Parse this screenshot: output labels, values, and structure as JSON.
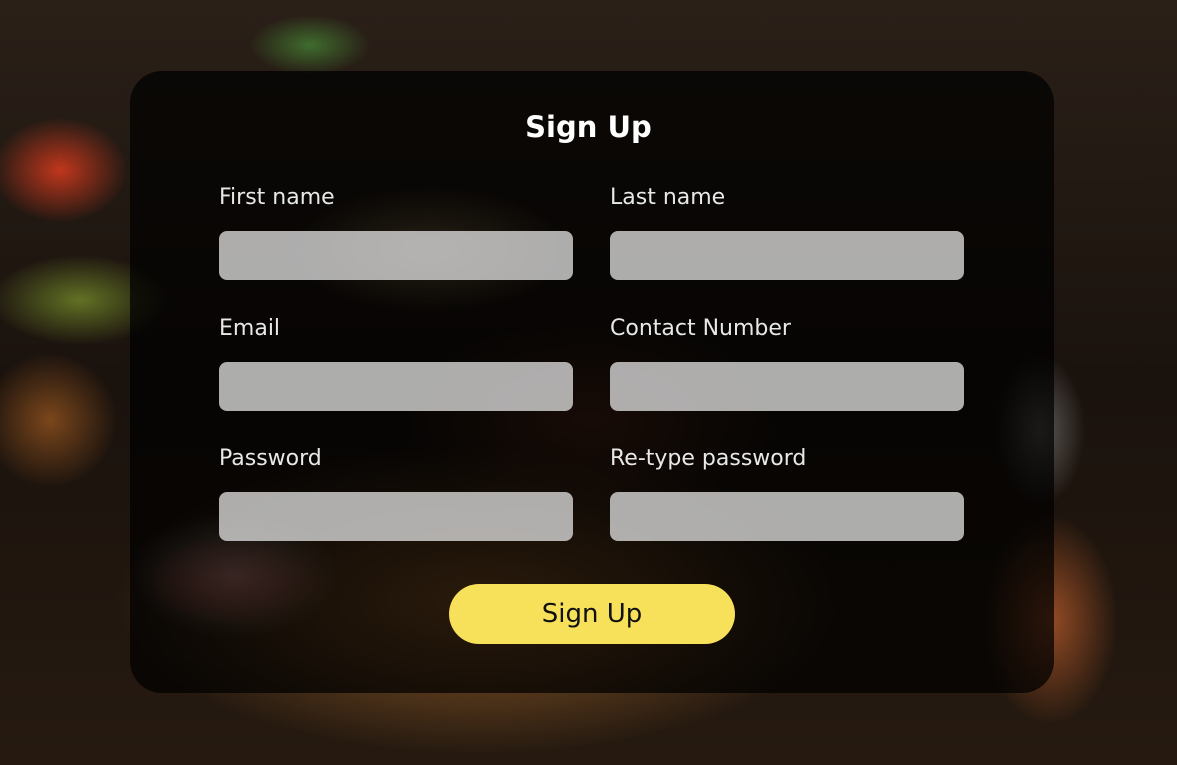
{
  "form": {
    "title": "Sign Up",
    "fields": [
      {
        "label": "First name",
        "value": "",
        "placeholder": ""
      },
      {
        "label": "Last name",
        "value": "",
        "placeholder": ""
      },
      {
        "label": "Email",
        "value": "",
        "placeholder": ""
      },
      {
        "label": "Contact Number",
        "value": "",
        "placeholder": ""
      },
      {
        "label": "Password",
        "value": "",
        "placeholder": ""
      },
      {
        "label": "Re-type password",
        "value": "",
        "placeholder": ""
      }
    ],
    "submit_label": "Sign Up"
  },
  "colors": {
    "button_accent": "#f7e05a",
    "card_background": "rgba(0,0,0,0.72)",
    "input_background": "rgba(220,220,220,0.78)",
    "text": "#ffffff"
  }
}
